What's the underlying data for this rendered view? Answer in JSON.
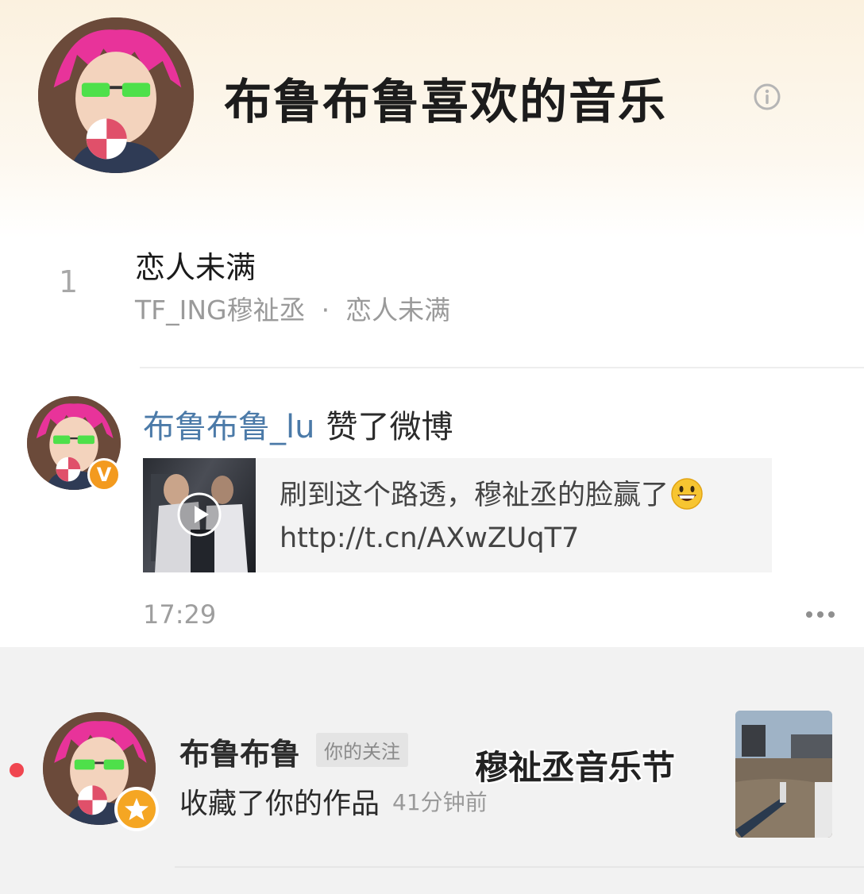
{
  "playlist": {
    "title": "布鲁布鲁喜欢的音乐",
    "track": {
      "index": "1",
      "title": "恋人未满",
      "artist": "TF_ING穆祉丞",
      "separator": "·",
      "album": "恋人未满"
    }
  },
  "like_post": {
    "user": "布鲁布鲁_lu",
    "action": "赞了微博",
    "badge": "V",
    "post_text_line1": "刷到这个路透，穆祉丞的脸赢了",
    "post_text_line2": "http://t.cn/AXwZUqT7",
    "time": "17:29"
  },
  "notification": {
    "name": "布鲁布鲁",
    "tag": "你的关注",
    "action": "收藏了你的作品",
    "time": "41分钟前",
    "overlay_text": "穆祉丞音乐节"
  },
  "colors": {
    "accent_link": "#4b7aa8",
    "verified_badge": "#f39a1e",
    "unread_dot": "#f04650"
  }
}
